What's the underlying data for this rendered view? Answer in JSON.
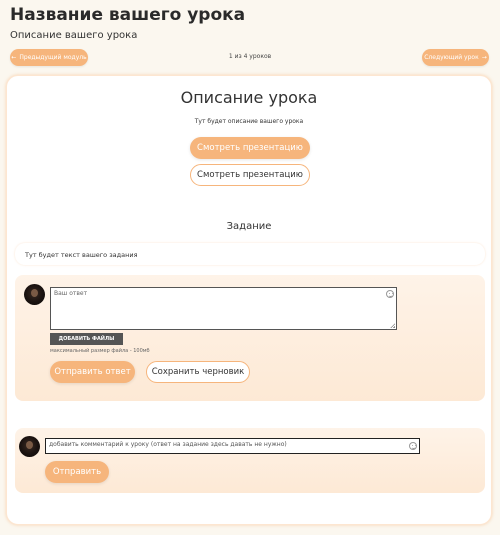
{
  "header": {
    "title": "Название вашего урока",
    "subtitle": "Описание вашего урока"
  },
  "navigation": {
    "prev_label": "Предыдущий модуль",
    "next_label": "Следующий урок",
    "counter": "1 из 4 уроков",
    "prev_icon": "arrow-left-icon",
    "next_icon": "arrow-right-icon"
  },
  "lesson": {
    "title": "Описание урока",
    "description": "Тут будет описание вашего урока",
    "view_button_filled": "Смотреть презентацию",
    "view_button_outline": "Смотреть презентацию"
  },
  "task": {
    "heading": "Задание",
    "text": "Тут будет текст вашего задания"
  },
  "answer": {
    "placeholder": "Ваш ответ",
    "upload_label": "ДОБАВИТЬ ФАЙЛЫ",
    "file_hint": "максимальный размер файла - 100мб",
    "submit_label": "Отправить ответ",
    "draft_label": "Сохранить черновик"
  },
  "comment": {
    "placeholder": "добавить комментарий к уроку (ответ на задание здесь давать не нужно)",
    "send_label": "Отправить"
  },
  "colors": {
    "accent": "#f6b57c",
    "background": "#fbf7ef",
    "panel": "#fdeedf"
  }
}
